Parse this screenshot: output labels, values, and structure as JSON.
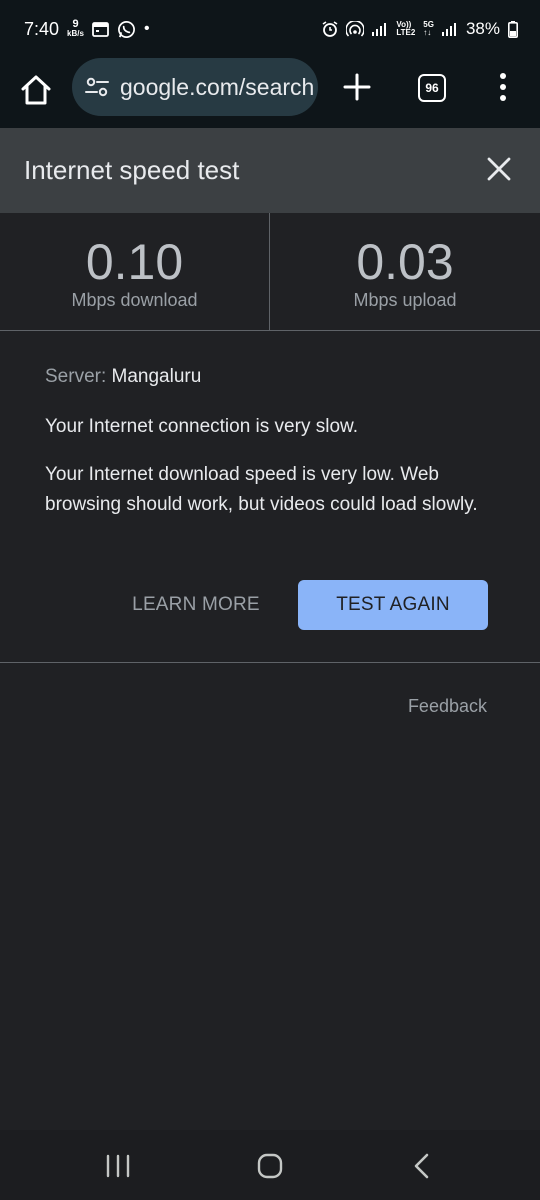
{
  "status_bar": {
    "time": "7:40",
    "net_speed_value": "9",
    "net_speed_unit": "kB/s",
    "volte_label": "Vo))",
    "lte_label": "LTE2",
    "network_label": "5G",
    "battery_percent": "38%"
  },
  "toolbar": {
    "url": "google.com/search",
    "tab_count": "96"
  },
  "panel": {
    "title": "Internet speed test"
  },
  "results": {
    "download_value": "0.10",
    "download_label": "Mbps download",
    "upload_value": "0.03",
    "upload_label": "Mbps upload"
  },
  "info": {
    "server_key": "Server:",
    "server_value": "Mangaluru",
    "summary": "Your Internet connection is very slow.",
    "detail": "Your Internet download speed is very low. Web browsing should work, but videos could load slowly."
  },
  "actions": {
    "learn_more": "LEARN MORE",
    "test_again": "TEST AGAIN"
  },
  "footer": {
    "feedback": "Feedback"
  },
  "colors": {
    "background": "#202124",
    "header": "#3c4043",
    "accent": "#8ab4f8",
    "omnibox": "#273a43"
  }
}
